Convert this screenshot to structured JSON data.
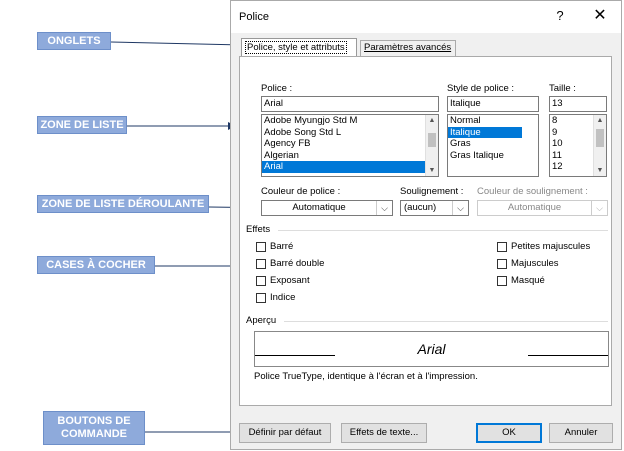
{
  "callouts": {
    "onglets": "ONGLETS",
    "zone_liste": "ZONE DE LISTE",
    "zone_liste_deroulante": "ZONE DE LISTE DÉROULANTE",
    "cases_a_cocher": "CASES À COCHER",
    "boutons_line1": "BOUTONS DE",
    "boutons_line2": "COMMANDE"
  },
  "dialog": {
    "title": "Police",
    "help": "?",
    "close": "✕",
    "tabs": [
      "Police, style et attributs",
      "Paramètres avancés"
    ],
    "font": {
      "label": "Police :",
      "value": "Arial",
      "items": [
        "Adobe Myungjo Std M",
        "Adobe Song Std L",
        "Agency FB",
        "Algerian",
        "Arial"
      ],
      "selected": "Arial"
    },
    "style": {
      "label": "Style de police :",
      "value": "Italique",
      "items": [
        "Normal",
        "Italique",
        "Gras",
        "Gras Italique"
      ],
      "selected": "Italique"
    },
    "size": {
      "label": "Taille :",
      "value": "13",
      "items": [
        "8",
        "9",
        "10",
        "11",
        "12"
      ]
    },
    "font_color": {
      "label": "Couleur de police :",
      "value": "Automatique"
    },
    "underline": {
      "label": "Soulignement :",
      "value": "(aucun)"
    },
    "underline_color": {
      "label": "Couleur de soulignement :",
      "value": "Automatique"
    },
    "effects": {
      "label": "Effets",
      "left": [
        "Barré",
        "Barré double",
        "Exposant",
        "Indice"
      ],
      "right": [
        "Petites majuscules",
        "Majuscules",
        "Masqué"
      ]
    },
    "preview": {
      "label": "Aperçu",
      "text": "Arial",
      "description": "Police TrueType, identique à l'écran et à l'impression."
    },
    "buttons": {
      "default": "Définir par défaut",
      "effects": "Effets de texte...",
      "ok": "OK",
      "cancel": "Annuler"
    }
  },
  "colors": {
    "callout_bg": "#8eaadb",
    "arrow": "#1f3864",
    "selection": "#0078d7"
  }
}
